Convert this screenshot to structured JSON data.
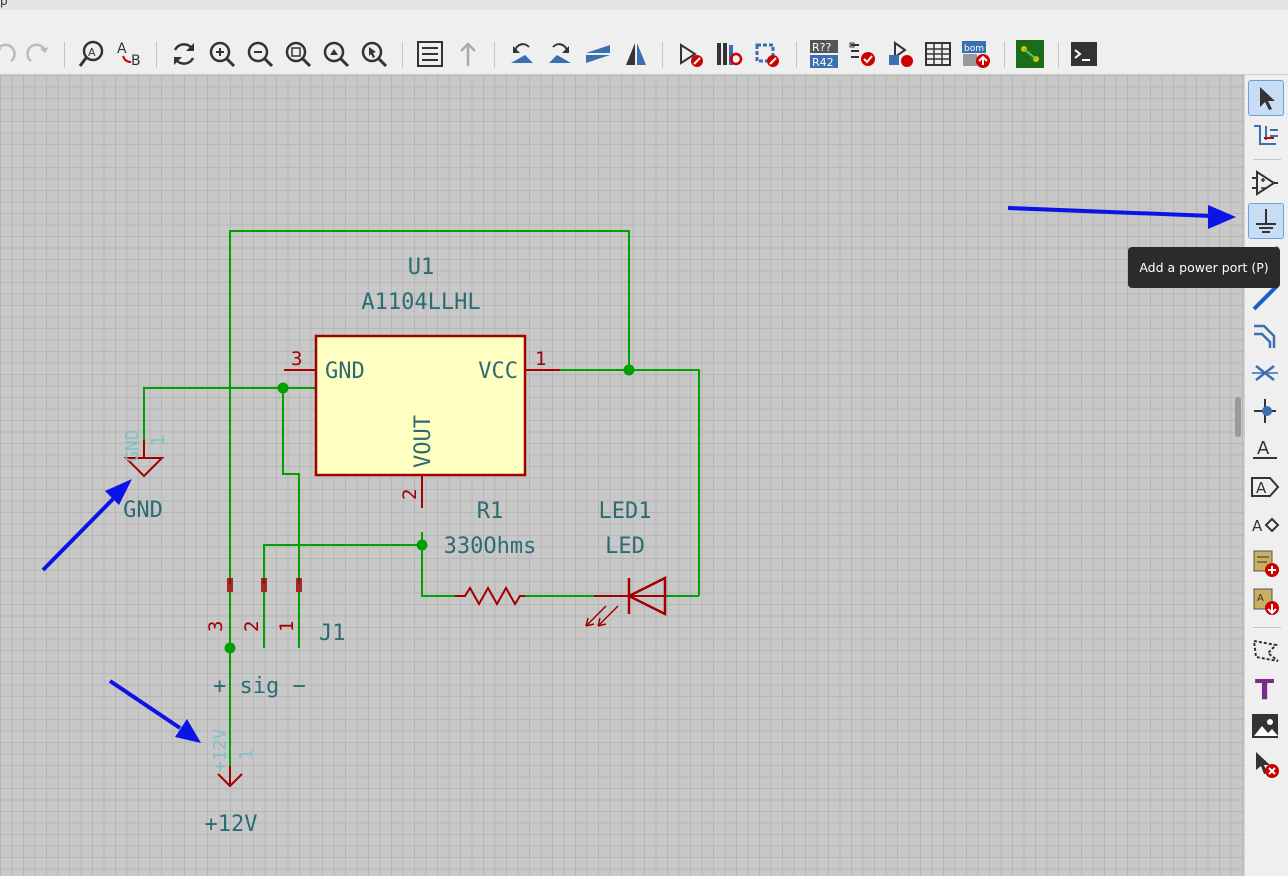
{
  "window": {
    "menu_fragment": "p"
  },
  "toolbar": {
    "buttons": [
      {
        "name": "undo-icon"
      },
      {
        "name": "redo-icon"
      },
      {
        "name": "find-icon"
      },
      {
        "name": "find-replace-icon"
      },
      {
        "name": "refresh-icon"
      },
      {
        "name": "zoom-in-icon"
      },
      {
        "name": "zoom-out-icon"
      },
      {
        "name": "zoom-fit-icon"
      },
      {
        "name": "zoom-objects-icon"
      },
      {
        "name": "zoom-selection-icon"
      },
      {
        "name": "hierarchy-navigator-icon"
      },
      {
        "name": "leave-sheet-icon"
      },
      {
        "name": "rotate-ccw-icon"
      },
      {
        "name": "rotate-cw-icon"
      },
      {
        "name": "mirror-vertical-icon"
      },
      {
        "name": "mirror-horizontal-icon"
      },
      {
        "name": "symbol-editor-icon"
      },
      {
        "name": "symbol-browser-icon"
      },
      {
        "name": "footprint-editor-icon"
      },
      {
        "name": "annotate-icon"
      },
      {
        "name": "erc-icon"
      },
      {
        "name": "assign-footprints-icon"
      },
      {
        "name": "symbol-fields-table-icon"
      },
      {
        "name": "generate-bom-icon"
      },
      {
        "name": "open-pcb-icon"
      },
      {
        "name": "scripting-console-icon"
      }
    ],
    "annotate_text_top": "R??",
    "annotate_text_bottom": "R42",
    "bom_text": "bom"
  },
  "right_toolbar": {
    "active_tool": "add-power-port",
    "tooltip": "Add a power port  (P)",
    "label_glyph": "A",
    "global_label_glyph": "A",
    "hier_label_glyph": "A",
    "text_glyph": "T"
  },
  "schematic": {
    "u1": {
      "ref": "U1",
      "value": "A1104LLHL",
      "pin_gnd": "GND",
      "pin_vcc": "VCC",
      "pin_vout": "VOUT",
      "pin3": "3",
      "pin1": "1",
      "pin2": "2"
    },
    "r1": {
      "ref": "R1",
      "value": "330Ohms"
    },
    "led1": {
      "ref": "LED1",
      "value": "LED"
    },
    "j1": {
      "ref": "J1",
      "pin3": "3",
      "pin2": "2",
      "pin1": "1",
      "pin_labels": "+ sig −"
    },
    "gnd_symbol": {
      "label": "GND",
      "pin_text": "GND",
      "pin_num": "1"
    },
    "vcc_symbol": {
      "label": "+12V",
      "pin_text": "+12V",
      "pin_num": "1"
    }
  },
  "colors": {
    "wire": "#00a000",
    "component": "#a00000",
    "body_fill": "#ffffc2",
    "annotation_arrow": "#0a14e6",
    "text": "#2b6c72"
  }
}
